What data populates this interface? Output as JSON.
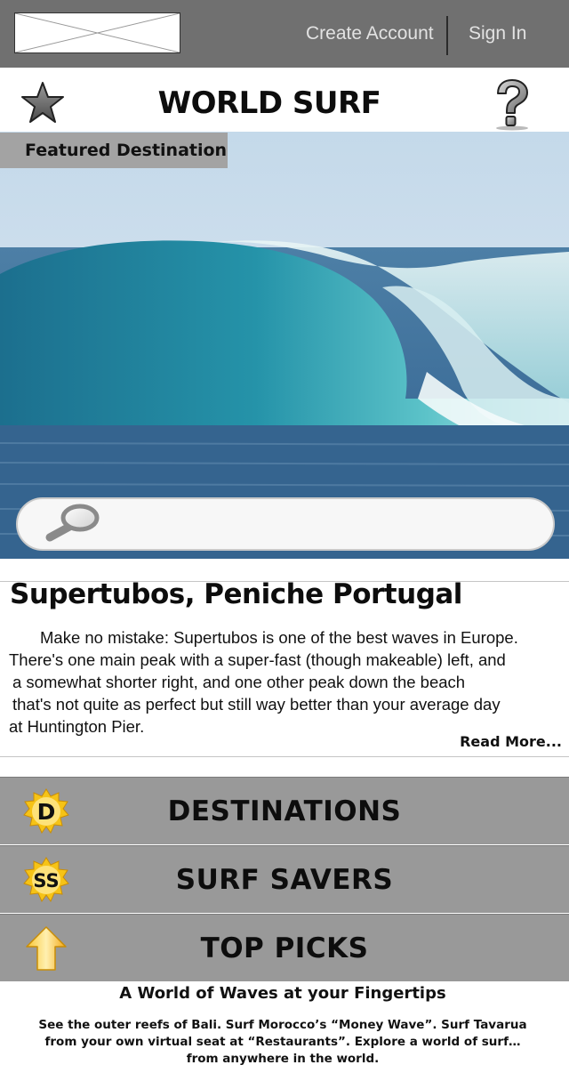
{
  "topbar": {
    "create_account": "Create Account",
    "sign_in": "Sign In"
  },
  "header": {
    "title": "WORLD SURF"
  },
  "hero": {
    "featured_label": "Featured Destination",
    "search_placeholder": ""
  },
  "article": {
    "title": "Supertubos, Peniche Portugal",
    "body_lines": [
      "Make no mistake: Supertubos is one of the best waves in Europe.",
      "There's one main peak with a super-fast (though makeable) left, and",
      "a somewhat shorter right, and one other peak down the beach",
      "that's not quite as perfect but still way better than your average day",
      "at Huntington Pier."
    ],
    "read_more": "Read More..."
  },
  "menu": [
    {
      "icon_letter": "D",
      "label": "DESTINATIONS"
    },
    {
      "icon_letter": "SS",
      "label": "SURF SAVERS"
    },
    {
      "icon_letter": "",
      "label": "TOP PICKS"
    }
  ],
  "footer": {
    "title": "A World of Waves at your Fingertips",
    "lines": [
      "See the outer reefs of Bali. Surf Morocco’s “Money Wave”. Surf Tavarua",
      "from your own virtual seat at “Restaurants”. Explore a world of surf…",
      "from anywhere in the world."
    ]
  },
  "colors": {
    "topbar_bg": "#707070",
    "menu_bg": "#999999",
    "featured_bg": "#a3a3a3",
    "badge_yellow": "#f2c21b"
  },
  "icons": {
    "logo": "placeholder-image",
    "favorite": "star-icon",
    "help": "question-mark-icon",
    "search": "magnifier-icon",
    "destinations": "d-badge-icon",
    "surf_savers": "ss-badge-icon",
    "top_picks": "up-arrow-icon"
  }
}
